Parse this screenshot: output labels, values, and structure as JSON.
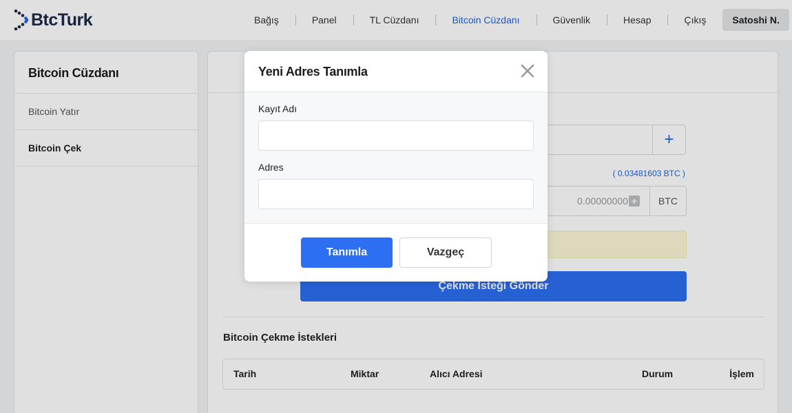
{
  "header": {
    "logo_text": "BtcTurk",
    "nav": [
      "Bağış",
      "Panel",
      "TL Cüzdanı",
      "Bitcoin Cüzdanı",
      "Güvenlik",
      "Hesap",
      "Çıkış"
    ],
    "active_nav": "Bitcoin Cüzdanı",
    "user_name": "Satoshi N."
  },
  "sidebar": {
    "title": "Bitcoin Cüzdanı",
    "items": [
      {
        "label": "Bitcoin Yatır",
        "active": false
      },
      {
        "label": "Bitcoin Çek",
        "active": true
      }
    ]
  },
  "main": {
    "add_address_symbol": "+",
    "balance": "( 0.03481603 BTC )",
    "amount_value": "0.00000000",
    "amount_unit": "BTC",
    "send_button": "Çekme İsteği Gönder",
    "requests_title": "Bitcoin Çekme İstekleri",
    "table_headers": [
      "Tarih",
      "Miktar",
      "Alıcı Adresi",
      "Durum",
      "İşlem"
    ]
  },
  "modal": {
    "title": "Yeni Adres Tanımla",
    "fields": [
      {
        "label": "Kayıt Adı",
        "value": "",
        "placeholder": ""
      },
      {
        "label": "Adres",
        "value": "",
        "placeholder": ""
      }
    ],
    "confirm_button": "Tanımla",
    "cancel_button": "Vazgeç"
  },
  "colors": {
    "accent": "#2c6ff2",
    "active_link": "#1a66e8",
    "warning_bg": "#fdf7d6",
    "brand_dark": "#1e2a4a"
  },
  "icons": {
    "logo": "btcturk-logo-icon",
    "close": "close-icon",
    "add": "plus-icon"
  }
}
